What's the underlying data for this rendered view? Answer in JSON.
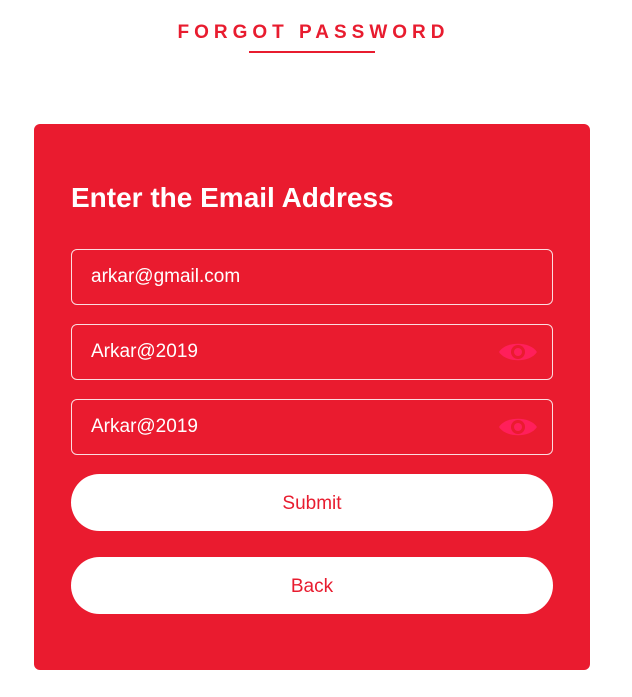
{
  "header": {
    "title": "FORGOT PASSWORD"
  },
  "card": {
    "heading": "Enter the Email Address",
    "email_field": {
      "value": "arkar@gmail.com"
    },
    "password_field": {
      "value": "Arkar@2019",
      "toggle_icon": "eye-icon"
    },
    "confirm_password_field": {
      "value": "Arkar@2019",
      "toggle_icon": "eye-icon"
    },
    "submit_label": "Submit",
    "back_label": "Back"
  },
  "colors": {
    "brand_red": "#ea1b2f",
    "title_red": "#e81c2f",
    "eye_icon": "#ff1f5a",
    "white": "#ffffff"
  }
}
